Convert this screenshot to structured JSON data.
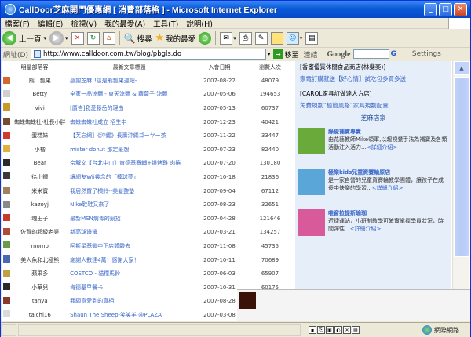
{
  "window": {
    "title": "CallDoor芝麻開門優惠網 [ 消費部落格 ] - Microsoft Internet Explorer",
    "min": "_",
    "max": "□",
    "close": "✕"
  },
  "menu": [
    "檔案(F)",
    "編輯(E)",
    "檢視(V)",
    "我的最愛(A)",
    "工具(T)",
    "說明(H)"
  ],
  "toolbar": {
    "back": "上一頁",
    "search": "搜尋",
    "favorites": "我的最愛"
  },
  "address": {
    "label": "網址(D)",
    "url": "http://www.calldoor.com.tw/blog/pbgls.do",
    "go": "移至",
    "links": "連結",
    "google": "Google",
    "google_g": "G",
    "settings": "Settings"
  },
  "table": {
    "headers": [
      "明星部落客",
      "最新文章標題",
      "入會日期",
      "瀏覽人次"
    ],
    "rows": [
      {
        "name": "熊．瓢果",
        "title": "感謝芝麻!!這是熊瓢果週吧-",
        "date": "2007-08-22",
        "views": "48079",
        "color": "#d2692c"
      },
      {
        "name": "Betty",
        "title": "全家一品涼麵 - 東天涼麵 & 蘿蔔子 涼麵",
        "date": "2007-05-06",
        "views": "194653",
        "color": "#cfcfcf"
      },
      {
        "name": "vivi",
        "title": "[廣告]我愛藤岳的理由",
        "date": "2007-05-13",
        "views": "60737",
        "color": "#c79a2a"
      },
      {
        "name": "蜘蛛蜘蛛社-社長小胖",
        "title": "蜘蛛蜘蛛社成立 招生中",
        "date": "2007-12-23",
        "views": "40421",
        "color": "#7a4a2a"
      },
      {
        "name": "蛋糕妹",
        "title": "【芙忘網】《沖繩》長壽沖繩ゴーヤー茶",
        "date": "2007-11-22",
        "views": "33447",
        "color": "#d23a2a"
      },
      {
        "name": "小楷",
        "title": "mister donut 那定最憩:",
        "date": "2007-07-23",
        "views": "82440",
        "color": "#e0b040"
      },
      {
        "name": "Bear",
        "title": "奈解文【台北中山】肯德基賽輔+燒烤雞 肉捲",
        "date": "2007-07-20",
        "views": "130180",
        "color": "#2a2a2a"
      },
      {
        "name": "徐小鐵",
        "title": "讓網友Wii幾念的「棒球夢」",
        "date": "2007-10-18",
        "views": "21836",
        "color": "#3a3a3a"
      },
      {
        "name": "米米寶",
        "title": "我居然買了槓鈴--美髮整墊",
        "date": "2007-09-04",
        "views": "67112",
        "color": "#a08060"
      },
      {
        "name": "kazoyj",
        "title": "Nike鞋鞋又來了",
        "date": "2007-08-23",
        "views": "32651",
        "color": "#8a8a8a"
      },
      {
        "name": "魂王子",
        "title": "最新MSN病毒的競招！",
        "date": "2007-04-28",
        "views": "121646",
        "color": "#c83a2a"
      },
      {
        "name": "佐賀的超級老婆",
        "title": "新高球邊邊",
        "date": "2007-03-21",
        "views": "134257",
        "color": "#b04a3a"
      },
      {
        "name": "momo",
        "title": "阿斯星基鎖中正店體驗去",
        "date": "2007-11-08",
        "views": "45735",
        "color": "#6a9a4a"
      },
      {
        "name": "美人魚和北極熊",
        "title": "謝謝人數達4萬！感謝大家！",
        "date": "2007-10-11",
        "views": "70689",
        "color": "#4a6ab0"
      },
      {
        "name": "蘋果多",
        "title": "COSTCO - 貓糧馬鈴",
        "date": "2007-06-03",
        "views": "65907",
        "color": "#c0a040"
      },
      {
        "name": "小華兒",
        "title": "肯德基早餐卡",
        "date": "2007-10-31",
        "views": "60175",
        "color": "#2a2a2a"
      },
      {
        "name": "tanya",
        "title": "我願意愛到的真相",
        "date": "2007-08-28",
        "views": "",
        "color": "#8a3a2a"
      },
      {
        "name": "taichi16",
        "title": "Shaun The Sheep-笑笑羊 @PLAZA",
        "date": "2007-03-08",
        "views": "",
        "color": "#dadada"
      }
    ]
  },
  "sidebar": {
    "line1": "[香蜜優質休閒食品商店(林斐奕)]",
    "line2": "家電訂購就送【好心情】試吃包多買多送",
    "line3": "[CAROL家具訂做達人方店]",
    "line4": "免費規劃”極簡風格”家具規劃配置",
    "section": "芝麻店家",
    "cards": [
      {
        "title": "綠緹補寶專賣",
        "text": "由花藝教師Mike領軍,以超視覺手法為補寶及各類活動注入活力...",
        "more": "詳細介紹",
        "color": "#6aaa3a"
      },
      {
        "title": "極樂kids兒童資賽輪原店",
        "text": "是一家自營的兒童資賽輪教學團體，讓孩子在成長中快樂的學習...",
        "more": "詳細介紹",
        "color": "#5aa6d8"
      },
      {
        "title": "唯窗拉提斯瑜珈",
        "text": "近捷運站，小班制教學可確實掌握學員狀況，時間彈性...",
        "more": "詳細介紹",
        "color": "#d85a9a"
      }
    ]
  },
  "status": {
    "zone": "網際網路"
  }
}
